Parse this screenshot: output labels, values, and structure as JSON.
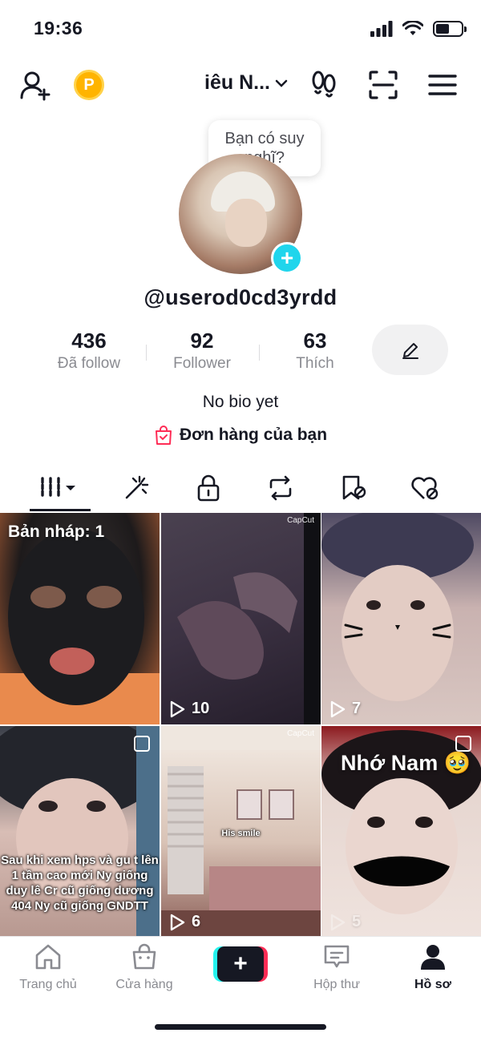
{
  "status": {
    "time": "19:36"
  },
  "header": {
    "account_name": "iêu N...",
    "coin_letter": "P"
  },
  "tooltip": {
    "line1": "Bạn có suy",
    "line2": "nghĩ?"
  },
  "profile": {
    "username": "@userod0cd3yrdd",
    "bio": "No bio yet",
    "orders_label": "Đơn hàng của bạn"
  },
  "stats": [
    {
      "value": "436",
      "label": "Đã follow"
    },
    {
      "value": "92",
      "label": "Follower"
    },
    {
      "value": "63",
      "label": "Thích"
    }
  ],
  "tabs": [
    "videos-icon",
    "sparkle-icon",
    "lock-icon",
    "repost-icon",
    "saved-icon",
    "liked-icon"
  ],
  "videos": [
    {
      "draft": "Bản nháp: 1"
    },
    {
      "plays": "10",
      "watermark": "CapCut"
    },
    {
      "plays": "7"
    },
    {
      "caption": "Sau khi xem hps và gu t lên 1 tầm cao mới Ny giống duy lê Cr cũ giống dương 404 Ny cũ giống GNDTT"
    },
    {
      "plays": "6",
      "watermark": "CapCut",
      "caption": "His smile"
    },
    {
      "plays": "5",
      "caption": "Nhớ Nam 🥹"
    }
  ],
  "bottom_nav": [
    {
      "label": "Trang chủ"
    },
    {
      "label": "Cửa hàng"
    },
    {
      "label": "Hộp thư"
    },
    {
      "label": "Hồ sơ"
    }
  ],
  "colors": {
    "cyan": "#25f4ee",
    "red": "#fe2c55",
    "add_blue": "#20d5ec",
    "coin": "#ffb400"
  }
}
